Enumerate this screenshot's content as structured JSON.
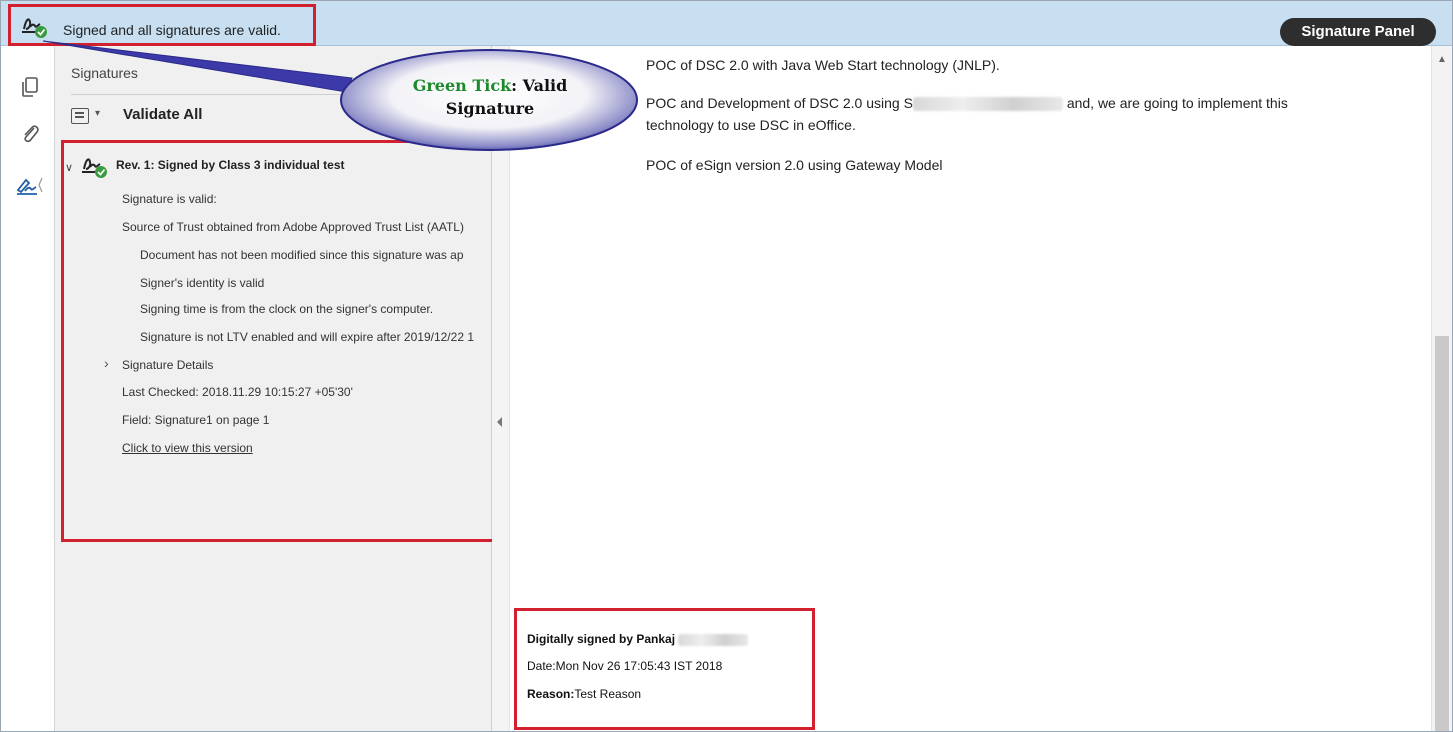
{
  "banner": {
    "status_text": "Signed and all signatures are valid.",
    "signature_panel_button": "Signature Panel"
  },
  "rail": {
    "icons": [
      "pages-icon",
      "attachment-icon",
      "signature-icon"
    ]
  },
  "panel": {
    "title": "Signatures",
    "validate_all": "Validate All",
    "revision_label": "Rev. 1: Signed by Class 3 individual test",
    "lines": {
      "sig_valid": "Signature is valid:",
      "source_trust": "Source of Trust obtained from Adobe Approved Trust List (AATL)",
      "not_modified": "Document has not been modified since this signature was ap",
      "identity_valid": "Signer's identity is valid",
      "signing_time": "Signing time is from the clock on the signer's computer.",
      "ltv": "Signature is not LTV enabled and will expire after 2019/12/22 1",
      "details": "Signature Details",
      "last_checked": "Last Checked: 2018.11.29 10:15:27 +05'30'",
      "field": "Field: Signature1 on page 1",
      "view_version": "Click to view this version"
    }
  },
  "callout": {
    "green_part": "Green Tick",
    "rest_line1": ": Valid",
    "line2": "Signature"
  },
  "document": {
    "line1": "POC of DSC 2.0 with Java Web Start technology (JNLP).",
    "line2a": "POC and Development of DSC 2.0 using S",
    "line2b": "and, we are going to implement this",
    "line3": "technology to use DSC in eOffice.",
    "line4": "POC of eSign version 2.0 using Gateway Model"
  },
  "signature_block": {
    "signed_by_label": "Digitally signed by Pankaj",
    "date": "Date:Mon Nov 26 17:05:43 IST 2018",
    "reason_label": "Reason:",
    "reason_value": "Test Reason"
  },
  "colors": {
    "banner_bg": "#c7dff1",
    "highlight_red": "#d3202e",
    "valid_green": "#3a9a3f",
    "callout_fill": "#3b3aa8"
  }
}
